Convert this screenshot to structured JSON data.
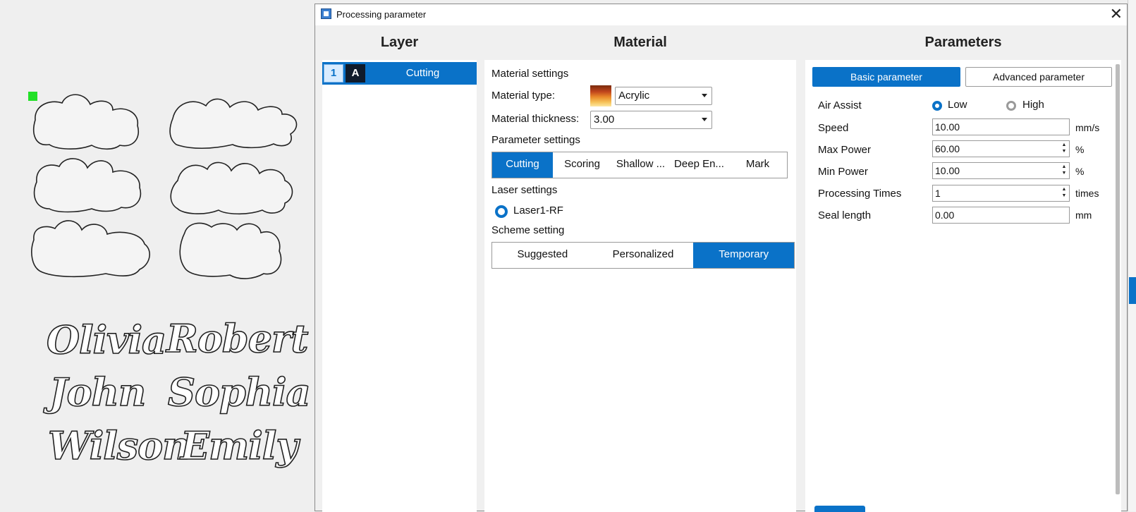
{
  "dialog": {
    "title": "Processing parameter",
    "close_glyph": "✕",
    "columns": {
      "layer": "Layer",
      "material": "Material",
      "parameters": "Parameters"
    }
  },
  "canvas": {
    "names": [
      "Olivia",
      "Robert",
      "John",
      "Sophia",
      "Wilson",
      "Emily"
    ]
  },
  "layer": {
    "number": "1",
    "mode": "A",
    "name": "Cutting"
  },
  "material": {
    "section": "Material settings",
    "type_label": "Material type:",
    "type_value": "Acrylic",
    "thickness_label": "Material thickness:",
    "thickness_value": "3.00",
    "param_section": "Parameter settings",
    "param_tabs": [
      "Cutting",
      "Scoring",
      "Shallow ...",
      "Deep En...",
      "Mark"
    ],
    "laser_section": "Laser settings",
    "laser_option": "Laser1-RF",
    "scheme_section": "Scheme setting",
    "scheme_tabs": [
      "Suggested",
      "Personalized",
      "Temporary"
    ]
  },
  "parameters": {
    "tab_basic": "Basic parameter",
    "tab_advanced": "Advanced parameter",
    "air_assist_label": "Air Assist",
    "air_low": "Low",
    "air_high": "High",
    "speed_label": "Speed",
    "speed_value": "10.00",
    "speed_unit": "mm/s",
    "max_power_label": "Max Power",
    "max_power_value": "60.00",
    "max_power_unit": "%",
    "min_power_label": "Min Power",
    "min_power_value": "10.00",
    "min_power_unit": "%",
    "times_label": "Processing Times",
    "times_value": "1",
    "times_unit": "times",
    "seal_label": "Seal length",
    "seal_value": "0.00",
    "seal_unit": "mm"
  },
  "colors": {
    "accent": "#0a72c8",
    "handle": "#22e027"
  }
}
